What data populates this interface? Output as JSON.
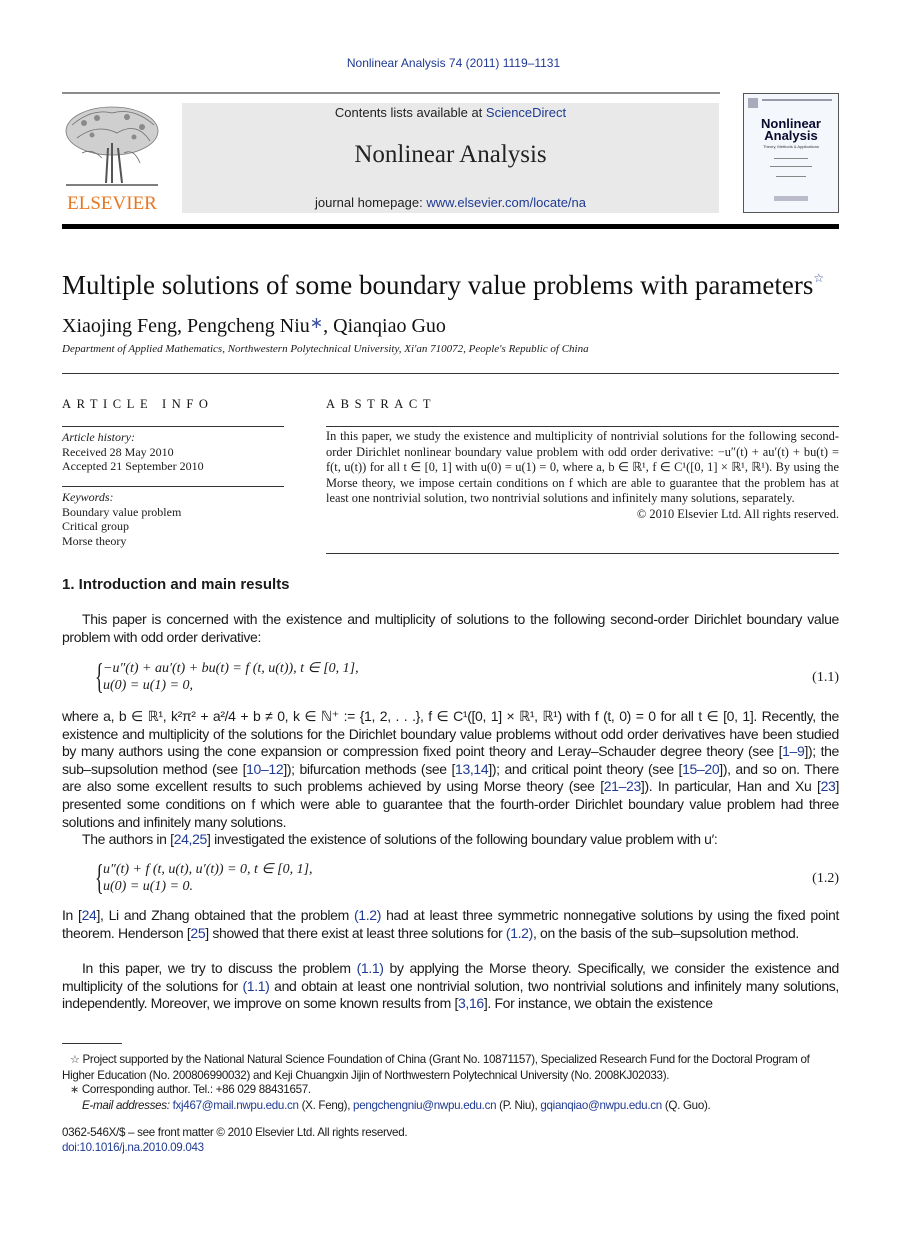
{
  "header": {
    "citation": "Nonlinear Analysis 74 (2011) 1119–1131",
    "publisher_logo_text": "ELSEVIER",
    "contents_prefix": "Contents lists available at ",
    "contents_link": "ScienceDirect",
    "journal_title": "Nonlinear Analysis",
    "homepage_prefix": "journal homepage: ",
    "homepage_link": "www.elsevier.com/locate/na",
    "cover_title_line1": "Nonlinear",
    "cover_title_line2": "Analysis",
    "cover_subtitle": "Theory, Methods & Applications"
  },
  "article": {
    "title": "Multiple solutions of some boundary value problems with parameters",
    "title_mark": "☆",
    "authors": [
      {
        "name": "Xiaojing Feng",
        "sep": ", "
      },
      {
        "name": "Pengcheng Niu",
        "mark": "∗",
        "sep": ", "
      },
      {
        "name": "Qianqiao Guo",
        "sep": ""
      }
    ],
    "affiliation": "Department of Applied Mathematics, Northwestern Polytechnical University, Xi'an 710072, People's Republic of China"
  },
  "article_info": {
    "heading": "ARTICLE INFO",
    "history_label": "Article history:",
    "received": "Received 28 May 2010",
    "accepted": "Accepted 21 September 2010",
    "keywords_label": "Keywords:",
    "keywords": [
      "Boundary value problem",
      "Critical group",
      "Morse theory"
    ]
  },
  "abstract": {
    "heading": "ABSTRACT",
    "text": "In this paper, we study the existence and multiplicity of nontrivial solutions for the following second-order Dirichlet nonlinear boundary value problem with odd order derivative: −u″(t) + au′(t) + bu(t) = f(t, u(t)) for all t ∈ [0, 1] with u(0) = u(1) = 0, where a, b ∈ ℝ¹, f ∈ C¹([0, 1] × ℝ¹, ℝ¹). By using the Morse theory, we impose certain conditions on f which are able to guarantee that the problem has at least one nontrivial solution, two nontrivial solutions and infinitely many solutions, separately.",
    "copyright": "© 2010 Elsevier Ltd. All rights reserved."
  },
  "section1": {
    "heading": "1.  Introduction and main results",
    "para1": "This paper is concerned with the existence and multiplicity of solutions to the following second-order Dirichlet boundary value problem with odd order derivative:",
    "eq1_line1": "−u″(t) + au′(t) + bu(t) = f (t, u(t)),     t ∈ [0, 1],",
    "eq1_line2": "u(0) = u(1) = 0,",
    "eq1_num": "(1.1)",
    "para2_parts": [
      {
        "t": "where a, b ∈ ℝ¹, k²π² + a²/4 + b ≠ 0, k ∈ ℕ⁺ := {1, 2, . . .}, f ∈ C¹([0, 1] × ℝ¹, ℝ¹) with f (t, 0) = 0 for all t ∈ [0, 1]. Recently, the existence and multiplicity of the solutions for the Dirichlet boundary value problems without odd order derivatives have been studied by many authors using the cone expansion or compression fixed point theory and Leray–Schauder degree theory (see ["
      },
      {
        "t": "1–9",
        "link": true
      },
      {
        "t": "]); the sub–supsolution method (see ["
      },
      {
        "t": "10–12",
        "link": true
      },
      {
        "t": "]); bifurcation methods (see ["
      },
      {
        "t": "13,14",
        "link": true
      },
      {
        "t": "]); and critical point theory (see ["
      },
      {
        "t": "15–20",
        "link": true
      },
      {
        "t": "]), and so on. There are also some excellent results to such problems achieved by using Morse theory (see ["
      },
      {
        "t": "21–23",
        "link": true
      },
      {
        "t": "]). In particular, Han and Xu ["
      },
      {
        "t": "23",
        "link": true
      },
      {
        "t": "] presented some conditions on f which were able to guarantee that the fourth-order Dirichlet boundary value problem had three solutions and infinitely many solutions."
      }
    ],
    "para3_parts": [
      {
        "t": "The authors in ["
      },
      {
        "t": "24,25",
        "link": true
      },
      {
        "t": "] investigated the existence of solutions of the following boundary value problem with u′:"
      }
    ],
    "eq2_line1": "u″(t) + f (t, u(t), u′(t)) = 0,     t ∈ [0, 1],",
    "eq2_line2": "u(0) = u(1) = 0.",
    "eq2_num": "(1.2)",
    "para4_parts": [
      {
        "t": "In ["
      },
      {
        "t": "24",
        "link": true
      },
      {
        "t": "], Li and Zhang obtained that the problem "
      },
      {
        "t": "(1.2)",
        "link": true
      },
      {
        "t": " had at least three symmetric nonnegative solutions by using the fixed point theorem. Henderson ["
      },
      {
        "t": "25",
        "link": true
      },
      {
        "t": "] showed that there exist at least three solutions for "
      },
      {
        "t": "(1.2)",
        "link": true
      },
      {
        "t": ", on the basis of the sub–supsolution method."
      }
    ],
    "para5_parts": [
      {
        "t": "In this paper, we try to discuss the problem "
      },
      {
        "t": "(1.1)",
        "link": true
      },
      {
        "t": " by applying the Morse theory. Specifically, we consider the existence and multiplicity of the solutions for "
      },
      {
        "t": "(1.1)",
        "link": true
      },
      {
        "t": " and obtain at least one nontrivial solution, two nontrivial solutions and infinitely many solutions, independently. Moreover, we improve on some known results from ["
      },
      {
        "t": "3,16",
        "link": true
      },
      {
        "t": "]. For instance, we obtain the existence"
      }
    ]
  },
  "footnotes": {
    "fund_mark": "☆",
    "fund_text": "Project supported by the National Natural Science Foundation of China (Grant No. 10871157), Specialized Research Fund for the Doctoral Program of Higher Education (No. 200806990032) and Keji Chuangxin Jijin of Northwestern Polytechnical University (No. 2008KJ02033).",
    "corr_mark": "∗",
    "corr_text": "Corresponding author. Tel.: +86 029 88431657.",
    "email_label": "E-mail addresses: ",
    "emails": [
      {
        "email": "fxj467@mail.nwpu.edu.cn",
        "who": " (X. Feng), "
      },
      {
        "email": "pengchengniu@nwpu.edu.cn",
        "who": " (P. Niu), "
      },
      {
        "email": "gqianqiao@nwpu.edu.cn",
        "who": " (Q. Guo)."
      }
    ]
  },
  "bottom": {
    "issn": "0362-546X/$ – see front matter © 2010 Elsevier Ltd. All rights reserved.",
    "doi": "doi:10.1016/j.na.2010.09.043"
  },
  "colors": {
    "link": "#1f3a93",
    "elsevier_orange": "#e87722",
    "banner_bg": "#e9e9e9"
  }
}
